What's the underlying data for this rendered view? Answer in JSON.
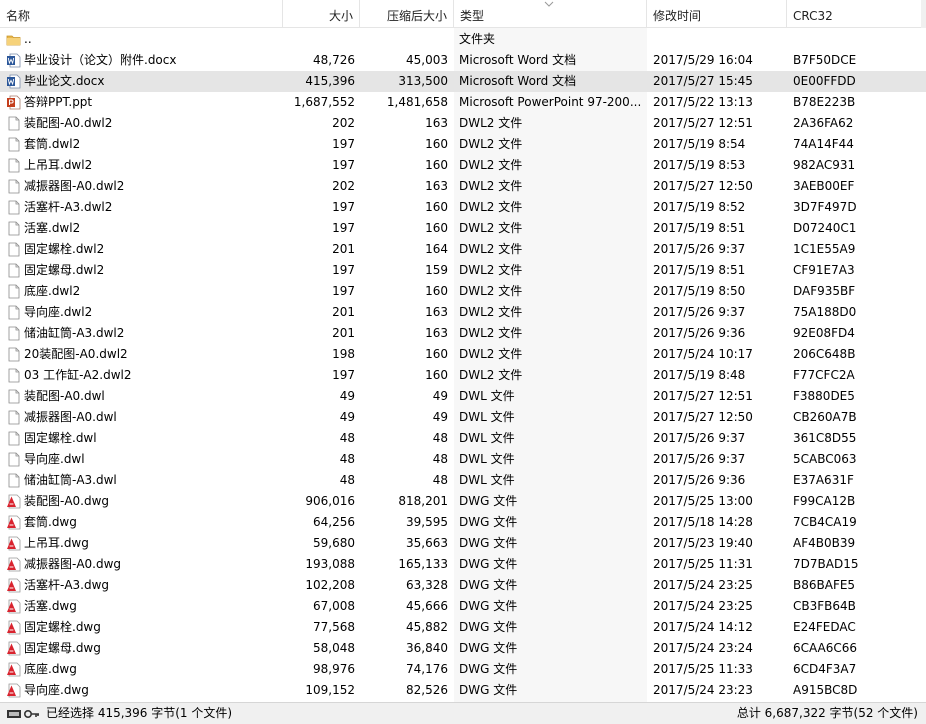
{
  "columns": {
    "name": "名称",
    "size": "大小",
    "packed": "压缩后大小",
    "type": "类型",
    "mtime": "修改时间",
    "crc": "CRC32"
  },
  "rows": [
    {
      "icon": "folder-up-icon",
      "name": "..",
      "size": "",
      "packed": "",
      "type": "文件夹",
      "mtime": "",
      "crc": "",
      "selected": false
    },
    {
      "icon": "word-doc-icon",
      "name": "毕业设计（论文）附件.docx",
      "size": "48,726",
      "packed": "45,003",
      "type": "Microsoft Word 文档",
      "mtime": "2017/5/29 16:04",
      "crc": "B7F50DCE",
      "selected": false
    },
    {
      "icon": "word-doc-icon",
      "name": "毕业论文.docx",
      "size": "415,396",
      "packed": "313,500",
      "type": "Microsoft Word 文档",
      "mtime": "2017/5/27 15:45",
      "crc": "0E00FFDD",
      "selected": true
    },
    {
      "icon": "ppt-icon",
      "name": "答辩PPT.ppt",
      "size": "1,687,552",
      "packed": "1,481,658",
      "type": "Microsoft PowerPoint 97-200...",
      "mtime": "2017/5/22 13:13",
      "crc": "B78E223B",
      "selected": false
    },
    {
      "icon": "file-icon",
      "name": "装配图-A0.dwl2",
      "size": "202",
      "packed": "163",
      "type": "DWL2 文件",
      "mtime": "2017/5/27 12:51",
      "crc": "2A36FA62",
      "selected": false
    },
    {
      "icon": "file-icon",
      "name": "套筒.dwl2",
      "size": "197",
      "packed": "160",
      "type": "DWL2 文件",
      "mtime": "2017/5/19 8:54",
      "crc": "74A14F44",
      "selected": false
    },
    {
      "icon": "file-icon",
      "name": "上吊耳.dwl2",
      "size": "197",
      "packed": "160",
      "type": "DWL2 文件",
      "mtime": "2017/5/19 8:53",
      "crc": "982AC931",
      "selected": false
    },
    {
      "icon": "file-icon",
      "name": "减振器图-A0.dwl2",
      "size": "202",
      "packed": "163",
      "type": "DWL2 文件",
      "mtime": "2017/5/27 12:50",
      "crc": "3AEB00EF",
      "selected": false
    },
    {
      "icon": "file-icon",
      "name": "活塞杆-A3.dwl2",
      "size": "197",
      "packed": "160",
      "type": "DWL2 文件",
      "mtime": "2017/5/19 8:52",
      "crc": "3D7F497D",
      "selected": false
    },
    {
      "icon": "file-icon",
      "name": "活塞.dwl2",
      "size": "197",
      "packed": "160",
      "type": "DWL2 文件",
      "mtime": "2017/5/19 8:51",
      "crc": "D07240C1",
      "selected": false
    },
    {
      "icon": "file-icon",
      "name": "固定螺栓.dwl2",
      "size": "201",
      "packed": "164",
      "type": "DWL2 文件",
      "mtime": "2017/5/26 9:37",
      "crc": "1C1E55A9",
      "selected": false
    },
    {
      "icon": "file-icon",
      "name": "固定螺母.dwl2",
      "size": "197",
      "packed": "159",
      "type": "DWL2 文件",
      "mtime": "2017/5/19 8:51",
      "crc": "CF91E7A3",
      "selected": false
    },
    {
      "icon": "file-icon",
      "name": "底座.dwl2",
      "size": "197",
      "packed": "160",
      "type": "DWL2 文件",
      "mtime": "2017/5/19 8:50",
      "crc": "DAF935BF",
      "selected": false
    },
    {
      "icon": "file-icon",
      "name": "导向座.dwl2",
      "size": "201",
      "packed": "163",
      "type": "DWL2 文件",
      "mtime": "2017/5/26 9:37",
      "crc": "75A188D0",
      "selected": false
    },
    {
      "icon": "file-icon",
      "name": "储油缸筒-A3.dwl2",
      "size": "201",
      "packed": "163",
      "type": "DWL2 文件",
      "mtime": "2017/5/26 9:36",
      "crc": "92E08FD4",
      "selected": false
    },
    {
      "icon": "file-icon",
      "name": "20装配图-A0.dwl2",
      "size": "198",
      "packed": "160",
      "type": "DWL2 文件",
      "mtime": "2017/5/24 10:17",
      "crc": "206C648B",
      "selected": false
    },
    {
      "icon": "file-icon",
      "name": "03 工作缸-A2.dwl2",
      "size": "197",
      "packed": "160",
      "type": "DWL2 文件",
      "mtime": "2017/5/19 8:48",
      "crc": "F77CFC2A",
      "selected": false
    },
    {
      "icon": "file-icon",
      "name": "装配图-A0.dwl",
      "size": "49",
      "packed": "49",
      "type": "DWL 文件",
      "mtime": "2017/5/27 12:51",
      "crc": "F3880DE5",
      "selected": false
    },
    {
      "icon": "file-icon",
      "name": "减振器图-A0.dwl",
      "size": "49",
      "packed": "49",
      "type": "DWL 文件",
      "mtime": "2017/5/27 12:50",
      "crc": "CB260A7B",
      "selected": false
    },
    {
      "icon": "file-icon",
      "name": "固定螺栓.dwl",
      "size": "48",
      "packed": "48",
      "type": "DWL 文件",
      "mtime": "2017/5/26 9:37",
      "crc": "361C8D55",
      "selected": false
    },
    {
      "icon": "file-icon",
      "name": "导向座.dwl",
      "size": "48",
      "packed": "48",
      "type": "DWL 文件",
      "mtime": "2017/5/26 9:37",
      "crc": "5CABC063",
      "selected": false
    },
    {
      "icon": "file-icon",
      "name": "储油缸筒-A3.dwl",
      "size": "48",
      "packed": "48",
      "type": "DWL 文件",
      "mtime": "2017/5/26 9:36",
      "crc": "E37A631F",
      "selected": false
    },
    {
      "icon": "dwg-icon",
      "name": "装配图-A0.dwg",
      "size": "906,016",
      "packed": "818,201",
      "type": "DWG 文件",
      "mtime": "2017/5/25 13:00",
      "crc": "F99CA12B",
      "selected": false
    },
    {
      "icon": "dwg-icon",
      "name": "套筒.dwg",
      "size": "64,256",
      "packed": "39,595",
      "type": "DWG 文件",
      "mtime": "2017/5/18 14:28",
      "crc": "7CB4CA19",
      "selected": false
    },
    {
      "icon": "dwg-icon",
      "name": "上吊耳.dwg",
      "size": "59,680",
      "packed": "35,663",
      "type": "DWG 文件",
      "mtime": "2017/5/23 19:40",
      "crc": "AF4B0B39",
      "selected": false
    },
    {
      "icon": "dwg-icon",
      "name": "减振器图-A0.dwg",
      "size": "193,088",
      "packed": "165,133",
      "type": "DWG 文件",
      "mtime": "2017/5/25 11:31",
      "crc": "7D7BAD15",
      "selected": false
    },
    {
      "icon": "dwg-icon",
      "name": "活塞杆-A3.dwg",
      "size": "102,208",
      "packed": "63,328",
      "type": "DWG 文件",
      "mtime": "2017/5/24 23:25",
      "crc": "B86BAFE5",
      "selected": false
    },
    {
      "icon": "dwg-icon",
      "name": "活塞.dwg",
      "size": "67,008",
      "packed": "45,666",
      "type": "DWG 文件",
      "mtime": "2017/5/24 23:25",
      "crc": "CB3FB64B",
      "selected": false
    },
    {
      "icon": "dwg-icon",
      "name": "固定螺栓.dwg",
      "size": "77,568",
      "packed": "45,882",
      "type": "DWG 文件",
      "mtime": "2017/5/24 14:12",
      "crc": "E24FEDAC",
      "selected": false
    },
    {
      "icon": "dwg-icon",
      "name": "固定螺母.dwg",
      "size": "58,048",
      "packed": "36,840",
      "type": "DWG 文件",
      "mtime": "2017/5/24 23:24",
      "crc": "6CAA6C66",
      "selected": false
    },
    {
      "icon": "dwg-icon",
      "name": "底座.dwg",
      "size": "98,976",
      "packed": "74,176",
      "type": "DWG 文件",
      "mtime": "2017/5/25 11:33",
      "crc": "6CD4F3A7",
      "selected": false
    },
    {
      "icon": "dwg-icon",
      "name": "导向座.dwg",
      "size": "109,152",
      "packed": "82,526",
      "type": "DWG 文件",
      "mtime": "2017/5/24 23:23",
      "crc": "A915BC8D",
      "selected": false
    }
  ],
  "status": {
    "left": "已经选择 415,396 字节(1 个文件)",
    "right": "总计 6,687,322 字节(52 个文件)",
    "icons": [
      "drive-icon",
      "key-icon"
    ]
  },
  "colors": {
    "selected_row": "#e5e5e5",
    "type_column_bg": "#f7f7f7",
    "word_blue": "#2b579a",
    "ppt_red": "#c43e1c",
    "dwg_red": "#d9232e"
  }
}
